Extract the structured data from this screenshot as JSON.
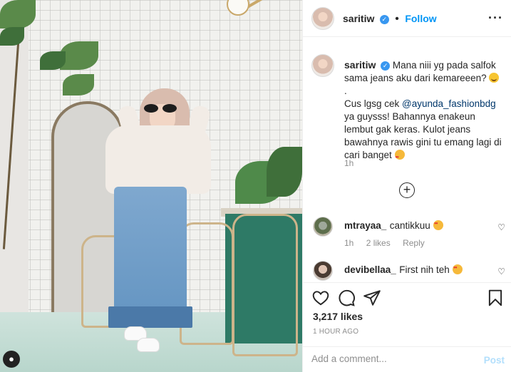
{
  "post": {
    "author": "saritiw",
    "verified_icon": "verified-check-icon",
    "follow_separator": "•",
    "follow_label": "Follow",
    "more_icon": "ellipsis-icon"
  },
  "caption": {
    "username": "saritiw",
    "line1": "Mana niii yg pada salfok sama jeans aku dari kemareeen?",
    "line2": ".",
    "line3_prefix": "Cus lgsg cek ",
    "mention": "@ayunda_fashionbdg",
    "line3_suffix": " ya guysss! Bahannya enakeun lembut gak keras. Kulot jeans bawahnya rawis gini tu emang lagi di cari banget",
    "time": "1h"
  },
  "load_more_icon": "plus-circle-icon",
  "comments": [
    {
      "username": "mtrayaa_",
      "text": "cantikkuu",
      "time": "1h",
      "likes": "2 likes",
      "reply": "Reply"
    },
    {
      "username": "devibellaa_",
      "text": "First nih teh"
    }
  ],
  "actions": {
    "like_icon": "heart-icon",
    "comment_icon": "comment-bubble-icon",
    "share_icon": "paper-plane-icon",
    "save_icon": "bookmark-icon"
  },
  "likes_count": "3,217 likes",
  "time_ago": "1 HOUR AGO",
  "add_comment": {
    "placeholder": "Add a comment...",
    "post_label": "Post"
  },
  "colors": {
    "accent": "#0095f6",
    "verified": "#3897f0",
    "post_disabled": "#b2dffc",
    "muted": "#8e8e8e"
  }
}
